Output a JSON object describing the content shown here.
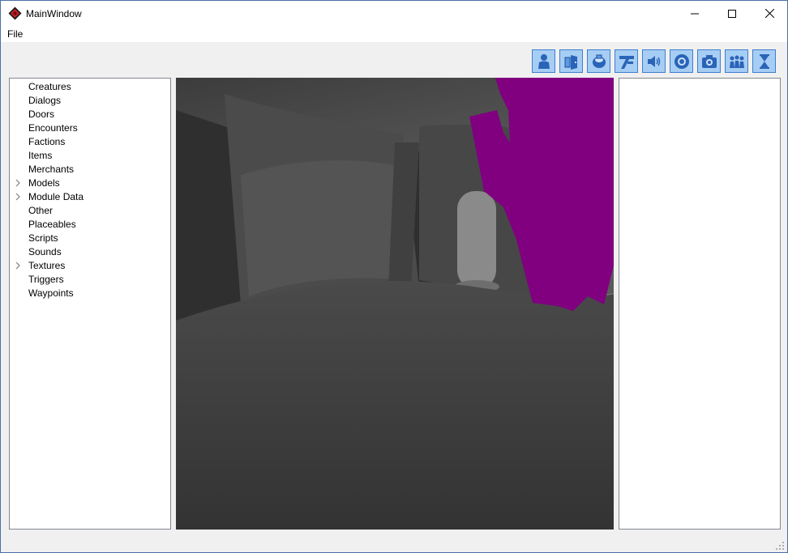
{
  "window": {
    "title": "MainWindow",
    "accent": "#4a6fa5",
    "controls": {
      "minimize": "minimize-icon",
      "maximize": "maximize-icon",
      "close": "close-icon"
    }
  },
  "menu": {
    "file": "File"
  },
  "toolbar": {
    "button_color": "#a6cdf3",
    "tools": [
      {
        "icon": "creature-icon"
      },
      {
        "icon": "door-icon"
      },
      {
        "icon": "placeable-icon"
      },
      {
        "icon": "trigger-icon"
      },
      {
        "icon": "sound-icon"
      },
      {
        "icon": "waypoint-icon"
      },
      {
        "icon": "camera-icon"
      },
      {
        "icon": "encounter-icon"
      },
      {
        "icon": "store-icon"
      }
    ]
  },
  "tree": {
    "items": [
      {
        "label": "Creatures",
        "expandable": false
      },
      {
        "label": "Dialogs",
        "expandable": false
      },
      {
        "label": "Doors",
        "expandable": false
      },
      {
        "label": "Encounters",
        "expandable": false
      },
      {
        "label": "Factions",
        "expandable": false
      },
      {
        "label": "Items",
        "expandable": false
      },
      {
        "label": "Merchants",
        "expandable": false
      },
      {
        "label": "Models",
        "expandable": true
      },
      {
        "label": "Module Data",
        "expandable": true
      },
      {
        "label": "Other",
        "expandable": false
      },
      {
        "label": "Placeables",
        "expandable": false
      },
      {
        "label": "Scripts",
        "expandable": false
      },
      {
        "label": "Sounds",
        "expandable": false
      },
      {
        "label": "Textures",
        "expandable": true
      },
      {
        "label": "Triggers",
        "expandable": false
      },
      {
        "label": "Waypoints",
        "expandable": false
      }
    ]
  },
  "viewport": {
    "placeholder_color": "#800080",
    "floor_color": "#3a3a3a"
  }
}
